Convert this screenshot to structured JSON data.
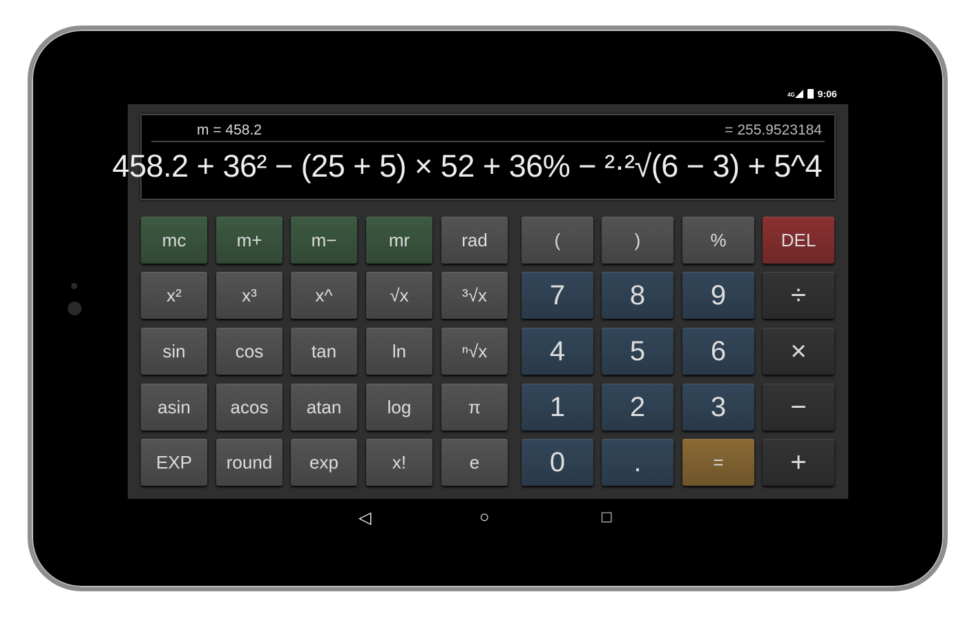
{
  "status_bar": {
    "network": "4G",
    "time": "9:06"
  },
  "display": {
    "memory": "m = 458.2",
    "result": "= 255.9523184",
    "expression": "458.2 + 36² − (25 + 5) × 52 + 36% − ²·²√(6 − 3) + 5^4"
  },
  "colors": {
    "memory": "#3d5a42",
    "function": "#545454",
    "digit": "#33475a",
    "operator": "#343434",
    "delete": "#8b3131",
    "equals": "#8a6a35"
  },
  "keypad": {
    "left_rows": [
      [
        {
          "label": "mc",
          "type": "memory"
        },
        {
          "label": "m+",
          "type": "memory"
        },
        {
          "label": "m−",
          "type": "memory"
        },
        {
          "label": "mr",
          "type": "memory"
        },
        {
          "label": "rad",
          "type": "function"
        }
      ],
      [
        {
          "label": "x²",
          "type": "function"
        },
        {
          "label": "x³",
          "type": "function"
        },
        {
          "label": "x^",
          "type": "function"
        },
        {
          "label": "√x",
          "type": "function"
        },
        {
          "label": "³√x",
          "type": "function"
        }
      ],
      [
        {
          "label": "sin",
          "type": "function"
        },
        {
          "label": "cos",
          "type": "function"
        },
        {
          "label": "tan",
          "type": "function"
        },
        {
          "label": "ln",
          "type": "function"
        },
        {
          "label": "ⁿ√x",
          "type": "function"
        }
      ],
      [
        {
          "label": "asin",
          "type": "function"
        },
        {
          "label": "acos",
          "type": "function"
        },
        {
          "label": "atan",
          "type": "function"
        },
        {
          "label": "log",
          "type": "function"
        },
        {
          "label": "π",
          "type": "function"
        }
      ],
      [
        {
          "label": "EXP",
          "type": "function"
        },
        {
          "label": "round",
          "type": "function"
        },
        {
          "label": "exp",
          "type": "function"
        },
        {
          "label": "x!",
          "type": "function"
        },
        {
          "label": "e",
          "type": "function"
        }
      ]
    ],
    "right_rows": [
      [
        {
          "label": "(",
          "type": "function"
        },
        {
          "label": ")",
          "type": "function"
        },
        {
          "label": "%",
          "type": "function"
        },
        {
          "label": "DEL",
          "type": "delete"
        }
      ],
      [
        {
          "label": "7",
          "type": "digit"
        },
        {
          "label": "8",
          "type": "digit"
        },
        {
          "label": "9",
          "type": "digit"
        },
        {
          "label": "÷",
          "type": "operator"
        }
      ],
      [
        {
          "label": "4",
          "type": "digit"
        },
        {
          "label": "5",
          "type": "digit"
        },
        {
          "label": "6",
          "type": "digit"
        },
        {
          "label": "×",
          "type": "operator"
        }
      ],
      [
        {
          "label": "1",
          "type": "digit"
        },
        {
          "label": "2",
          "type": "digit"
        },
        {
          "label": "3",
          "type": "digit"
        },
        {
          "label": "−",
          "type": "operator"
        }
      ],
      [
        {
          "label": "0",
          "type": "digit"
        },
        {
          "label": ".",
          "type": "digit"
        },
        {
          "label": "=",
          "type": "equals"
        },
        {
          "label": "+",
          "type": "operator"
        }
      ]
    ]
  },
  "nav_bar": {
    "back_icon": "◁",
    "home_icon": "○",
    "recents_icon": "□"
  }
}
